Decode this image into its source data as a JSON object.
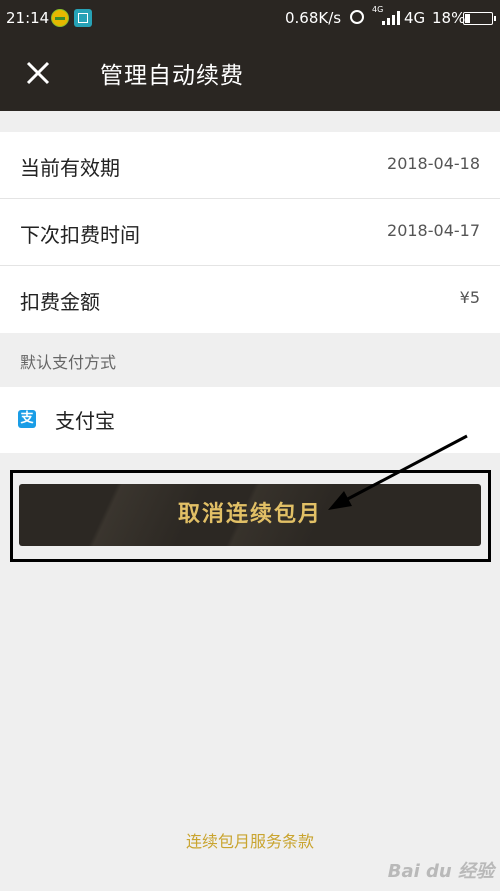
{
  "status_bar": {
    "time": "21:14",
    "network_speed": "0.68K/s",
    "small_network": "4G",
    "network": "4G",
    "battery": "18%",
    "battery_level": 0.18
  },
  "header": {
    "title": "管理自动续费",
    "close_icon": "close-icon"
  },
  "details": [
    {
      "label": "当前有效期",
      "value": "2018-04-18"
    },
    {
      "label": "下次扣费时间",
      "value": "2018-04-17"
    },
    {
      "label": "扣费金额",
      "value": "¥5"
    }
  ],
  "payment": {
    "section_label": "默认支付方式",
    "icon_glyph": "支",
    "method": "支付宝"
  },
  "action": {
    "cancel_label": "取消连续包月"
  },
  "footer": {
    "terms_link": "连续包月服务条款"
  },
  "watermark": {
    "text": "Bai du 经验"
  },
  "colors": {
    "header_bg": "#2a2622",
    "accent_gold": "#e2c066",
    "link_gold": "#c9a42f",
    "alipay_blue": "#1a9de6",
    "page_bg": "#efefef"
  }
}
